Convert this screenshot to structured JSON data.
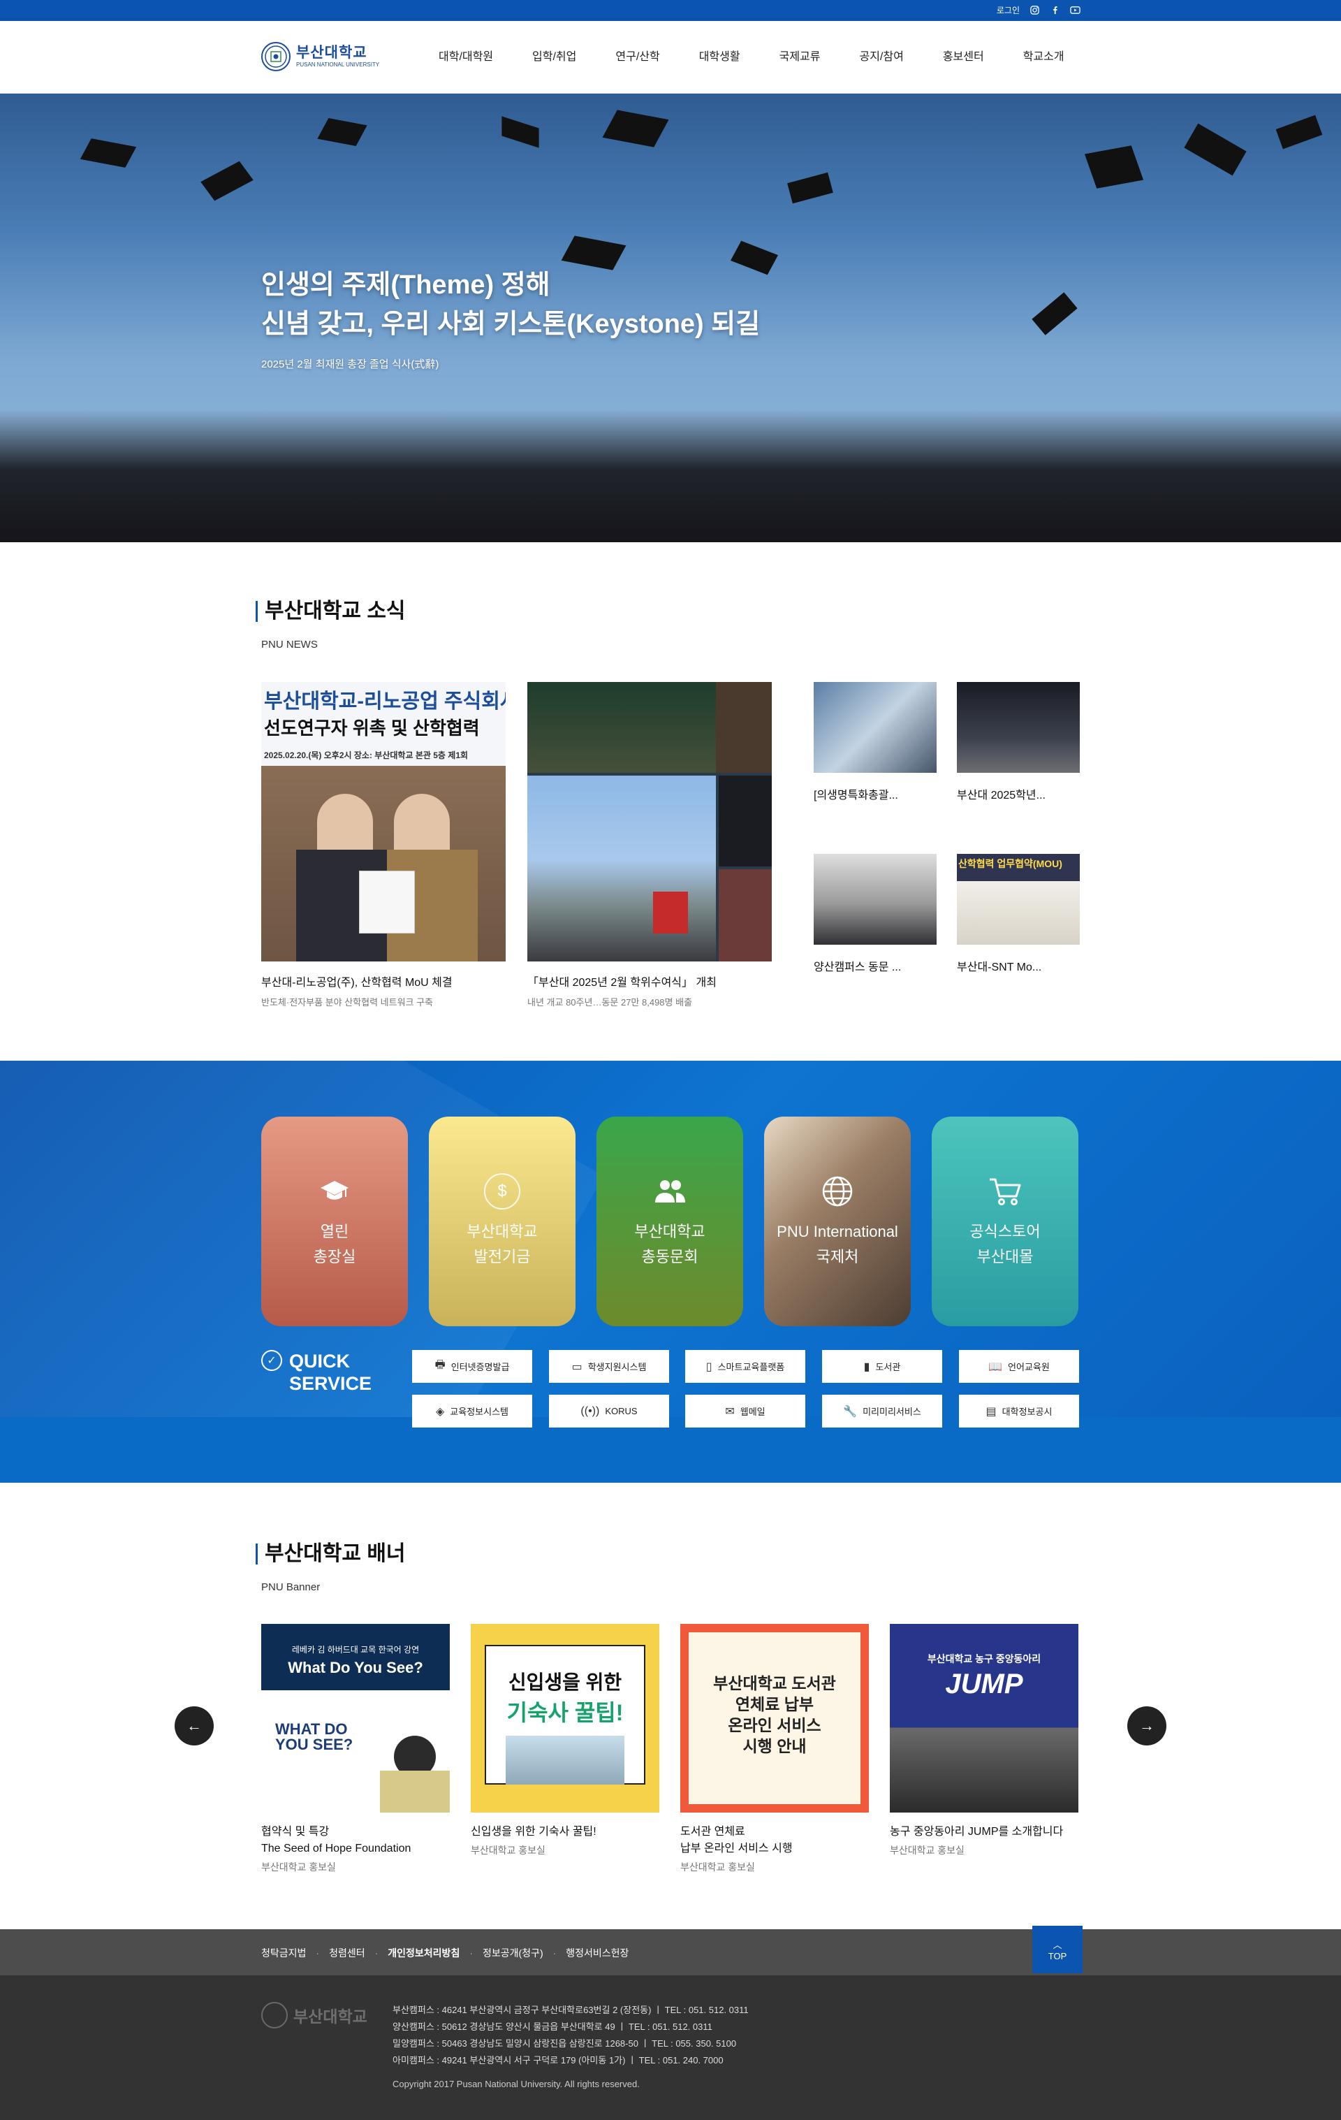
{
  "util": {
    "login": "로그인"
  },
  "header": {
    "logo_kr": "부산대학교",
    "logo_en": "PUSAN NATIONAL UNIVERSITY",
    "nav": [
      "대학/대학원",
      "입학/취업",
      "연구/산학",
      "대학생활",
      "국제교류",
      "공지/참여",
      "홍보센터",
      "학교소개"
    ]
  },
  "hero": {
    "line1": "인생의 주제(Theme) 정해",
    "line2": "신념 갖고, 우리 사회 키스톤(Keystone) 되길",
    "caption": "2025년 2월 최재원 총장 졸업 식사(式辭)"
  },
  "news": {
    "title": "부산대학교 소식",
    "subtitle": "PNU NEWS",
    "big": [
      {
        "title": "부산대-리노공업(주), 산학협력 MoU 체결",
        "desc": "반도체·전자부품 분야 산학협력 네트워크 구축",
        "img_text1": "부산대학교-리노공업 주식회사",
        "img_text2": "선도연구자 위촉 및 산학협력",
        "img_text3": "2025.02.20.(목) 오후2시   장소: 부산대학교 본관 5층 제1회"
      },
      {
        "title": "「부산대 2025년 2월 학위수여식」 개최",
        "desc": "내년 개교 80주년…동문 27만 8,498명 배출"
      }
    ],
    "small": [
      {
        "title": "[의생명특화총괄..."
      },
      {
        "title": "부산대 2025학년..."
      },
      {
        "title": "양산캠퍼스 동문 ..."
      },
      {
        "title": "부산대-SNT Mo...",
        "img_text": "산학협력 업무협약(MOU)"
      }
    ]
  },
  "services": {
    "cards": [
      {
        "l1": "열린",
        "l2": "총장실",
        "icon": "graduation-cap-icon",
        "color": "#c96a5d"
      },
      {
        "l1": "부산대학교",
        "l2": "발전기금",
        "icon": "dollar-coin-icon",
        "color": "#dbc76a"
      },
      {
        "l1": "부산대학교",
        "l2": "총동문회",
        "icon": "users-icon",
        "color": "#5f9433"
      },
      {
        "l1": "PNU International",
        "l2": "국제처",
        "icon": "globe-icon",
        "color": "#8a7a6a"
      },
      {
        "l1": "공식스토어",
        "l2": "부산대몰",
        "icon": "cart-icon",
        "color": "#3aabab"
      }
    ],
    "quick_title1": "QUICK",
    "quick_title2": "SERVICE",
    "quick": [
      {
        "label": "인터넷증명발급",
        "icon": "printer-icon"
      },
      {
        "label": "학생지원시스템",
        "icon": "monitor-icon"
      },
      {
        "label": "스마트교육플랫폼",
        "icon": "mobile-icon"
      },
      {
        "label": "도서관",
        "icon": "book-icon"
      },
      {
        "label": "언어교육원",
        "icon": "open-book-icon"
      },
      {
        "label": "교육정보시스템",
        "icon": "layers-icon"
      },
      {
        "label": "KORUS",
        "icon": "broadcast-icon"
      },
      {
        "label": "웹메일",
        "icon": "mail-icon"
      },
      {
        "label": "미리미리서비스",
        "icon": "wrench-icon"
      },
      {
        "label": "대학정보공시",
        "icon": "document-icon"
      }
    ]
  },
  "banner": {
    "title": "부산대학교 배너",
    "subtitle": "PNU Banner",
    "items": [
      {
        "t1": "협약식 및 특강",
        "t2": "The Seed of Hope Foundation",
        "s": "부산대학교 홍보실",
        "img1": "레베카 김 하버드대 교목 한국어 강연",
        "img2": "What Do You See?",
        "img3": "WHAT DO YOU SEE?"
      },
      {
        "t1": "신입생을 위한 기숙사 꿀팁!",
        "t2": "",
        "s": "부산대학교 홍보실",
        "img1": "신입생을 위한",
        "img2": "기숙사 꿀팁!"
      },
      {
        "t1": "도서관 연체료",
        "t2": "납부 온라인 서비스 시행",
        "s": "부산대학교 홍보실",
        "img1": "부산대학교 도서관",
        "img2": "연체료 납부",
        "img3": "온라인 서비스",
        "img4": "시행 안내"
      },
      {
        "t1": "농구 중앙동아리 JUMP를 소개합니다",
        "t2": "",
        "s": "부산대학교 홍보실",
        "img1": "부산대학교 농구 중앙동아리",
        "img2": "JUMP"
      }
    ]
  },
  "footer": {
    "links": [
      "청탁금지법",
      "청렴센터",
      "개인정보처리방침",
      "정보공개(청구)",
      "행정서비스헌장"
    ],
    "top": "TOP",
    "logo_kr": "부산대학교",
    "addr": [
      "부산캠퍼스 : 46241 부산광역시 금정구 부산대학로63번길 2 (장전동)  ㅣ  TEL : 051. 512. 0311",
      "양산캠퍼스 : 50612 경상남도 양산시 물금읍 부산대학로 49  ㅣ  TEL : 051. 512. 0311",
      "밀양캠퍼스 : 50463 경상남도 밀양시 삼랑진읍 삼랑진로 1268-50  ㅣ  TEL : 055. 350. 5100",
      "아미캠퍼스 : 49241 부산광역시 서구 구덕로 179 (아미동 1가)  ㅣ  TEL : 051. 240. 7000"
    ],
    "copyright": "Copyright 2017 Pusan National University. All rights reserved."
  }
}
